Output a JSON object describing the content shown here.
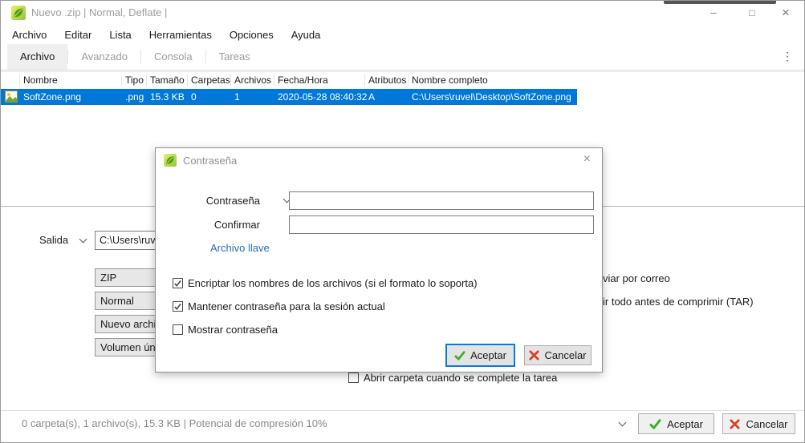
{
  "window": {
    "title": "Nuevo .zip | Normal, Deflate |",
    "minimize_glyph": "–",
    "maximize_glyph": "□",
    "close_glyph": "×"
  },
  "menu": {
    "items": [
      "Archivo",
      "Editar",
      "Lista",
      "Herramientas",
      "Opciones",
      "Ayuda"
    ]
  },
  "tabs": {
    "items": [
      "Archivo",
      "Avanzado",
      "Consola",
      "Tareas"
    ],
    "active": "Archivo",
    "overflow_glyph": "⋮"
  },
  "file_table": {
    "columns": [
      "Nombre",
      "Tipo",
      "Tamaño",
      "Carpetas",
      "Archivos",
      "Fecha/Hora",
      "Atributos",
      "Nombre completo"
    ],
    "row": {
      "nombre": "SoftZone.png",
      "tipo": ".png",
      "tamano": "15.3 KB",
      "carpetas": "0",
      "archivos": "1",
      "fecha_hora": "2020-05-28 08:40:32",
      "atributos": "A",
      "nombre_completo": "C:\\Users\\ruvel\\Desktop\\SoftZone.png"
    },
    "selection_color": "#0078d7"
  },
  "output_panel": {
    "salida_label": "Salida",
    "salida_value": "C:\\Users\\ruve",
    "format_buttons": [
      "ZIP",
      "Normal",
      "Nuevo archiv",
      "Volumen úni"
    ],
    "right_fragments": [
      "viar por correo",
      "ir todo antes de comprimir (TAR)"
    ],
    "open_folder_checkbox": "Abrir carpeta cuando se complete la tarea"
  },
  "dialog": {
    "title": "Contraseña",
    "close_glyph": "×",
    "password_label": "Contraseña",
    "password_value": "",
    "confirm_label": "Confirmar",
    "confirm_value": "",
    "keyfile_link": "Archivo llave",
    "checkboxes": [
      {
        "label": "Encriptar los nombres de los archivos (si el formato lo soporta)",
        "checked": true
      },
      {
        "label": "Mantener contraseña para la sesión actual",
        "checked": true
      },
      {
        "label": "Mostrar contraseña",
        "checked": false
      }
    ],
    "ok_label": "Aceptar",
    "cancel_label": "Cancelar"
  },
  "status_bar": {
    "summary": "0 carpeta(s), 1 archivo(s), 15.3 KB | Potencial de compresión 10%",
    "ok_label": "Aceptar",
    "cancel_label": "Cancelar"
  },
  "colors": {
    "selection": "#0078d7",
    "accent_green": "#3fae2a",
    "accent_red": "#d8402a",
    "link_blue": "#2b6cb8"
  }
}
